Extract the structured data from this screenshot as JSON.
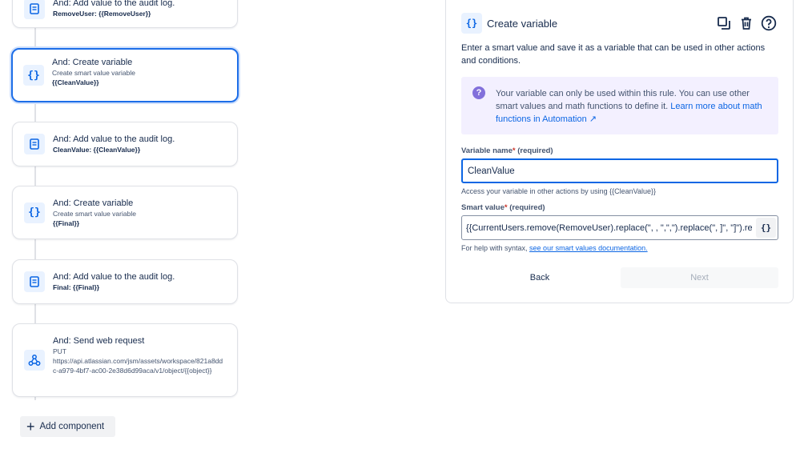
{
  "flow": {
    "cards": [
      {
        "icon": "audit-log-icon",
        "title": "And: Add value to the audit log.",
        "lines": [
          "RemoveUser: {{RemoveUser}}"
        ]
      },
      {
        "icon": "variable-braces-icon",
        "title": "And: Create variable",
        "lines": [
          "Create smart value variable",
          "{{CleanValue}}"
        ],
        "selected": true
      },
      {
        "icon": "audit-log-icon",
        "title": "And: Add value to the audit log.",
        "lines": [
          "CleanValue: {{CleanValue}}"
        ]
      },
      {
        "icon": "variable-braces-icon",
        "title": "And: Create variable",
        "lines": [
          "Create smart value variable",
          "{{Final}}"
        ]
      },
      {
        "icon": "audit-log-icon",
        "title": "And: Add value to the audit log.",
        "lines": [
          "Final: {{Final}}"
        ]
      },
      {
        "icon": "webhook-icon",
        "title": "And: Send web request",
        "lines": [
          "PUT",
          "https://api.atlassian.com/jsm/assets/workspace/821a8ddc-a979-4bf7-ac00-2e38d6d99aca/v1/object/{{object}}"
        ]
      }
    ],
    "add_component_label": "Add component"
  },
  "panel": {
    "header_icon_text": "{}",
    "title": "Create variable",
    "actions": [
      "duplicate-icon",
      "trash-icon",
      "help-icon"
    ],
    "description": "Enter a smart value and save it as a variable that can be used in other actions and conditions.",
    "info": {
      "text": "Your variable can only be used within this rule. You can use other smart values and math functions to define it. ",
      "link": "Learn more about math functions in Automation ↗"
    },
    "variable_name": {
      "label": "Variable name",
      "required_mark": "*",
      "required_text": "(required)",
      "value": "CleanValue",
      "helper": "Access your variable in other actions by using {{CleanValue}}"
    },
    "smart_value": {
      "label": "Smart value",
      "required_mark": "*",
      "required_text": "(required)",
      "value": "{{CurrentUsers.remove(RemoveUser).replace(\", , \",\",\").replace(\", ]\", \"]\").replace(\"[, \", \"[\")}}",
      "button_text": "{}",
      "helper_prefix": "For help with syntax, ",
      "helper_link": "see our smart values documentation."
    },
    "back_label": "Back",
    "next_label": "Next"
  },
  "colors": {
    "accent": "#0c66e4",
    "selected_border": "#1d6ee8",
    "info_bg": "#f3f0ff",
    "info_icon": "#8270db",
    "required": "#c9372c"
  }
}
